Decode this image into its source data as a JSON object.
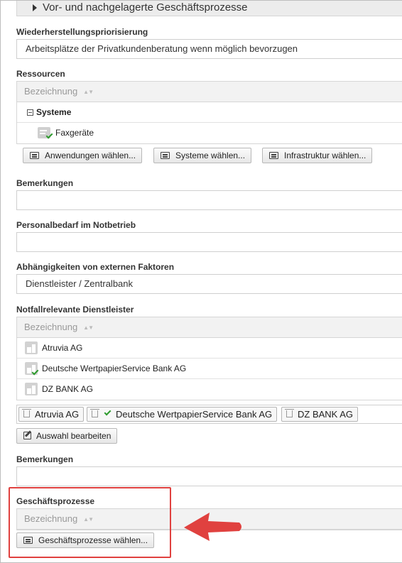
{
  "header": {
    "title": "Vor- und nachgelagerte Geschäftsprozesse"
  },
  "recovery": {
    "label": "Wiederherstellungspriorisierung",
    "value": "Arbeitsplätze der Privatkundenberatung wenn möglich bevorzugen"
  },
  "resources": {
    "label": "Ressourcen",
    "column": "Bezeichnung",
    "group": "Systeme",
    "item": "Faxgeräte",
    "buttons": {
      "apps": "Anwendungen wählen...",
      "systems": "Systeme wählen...",
      "infra": "Infrastruktur wählen..."
    }
  },
  "remarks1": {
    "label": "Bemerkungen",
    "value": ""
  },
  "personnel": {
    "label": "Personalbedarf im Notbetrieb",
    "value": ""
  },
  "dependencies": {
    "label": "Abhängigkeiten von externen Faktoren",
    "value": "Dienstleister / Zentralbank"
  },
  "providers": {
    "label": "Notfallrelevante Dienstleister",
    "column": "Bezeichnung",
    "rows": [
      "Atruvia AG",
      "Deutsche WertpapierService Bank AG",
      "DZ BANK AG"
    ],
    "tags": [
      "Atruvia AG",
      "Deutsche WertpapierService Bank AG",
      "DZ BANK AG"
    ],
    "edit_button": "Auswahl bearbeiten"
  },
  "remarks2": {
    "label": "Bemerkungen",
    "value": ""
  },
  "processes": {
    "label": "Geschäftsprozesse",
    "column": "Bezeichnung",
    "button": "Geschäftsprozesse wählen..."
  },
  "colors": {
    "highlight": "#e0413f",
    "check": "#2e9b2e"
  }
}
